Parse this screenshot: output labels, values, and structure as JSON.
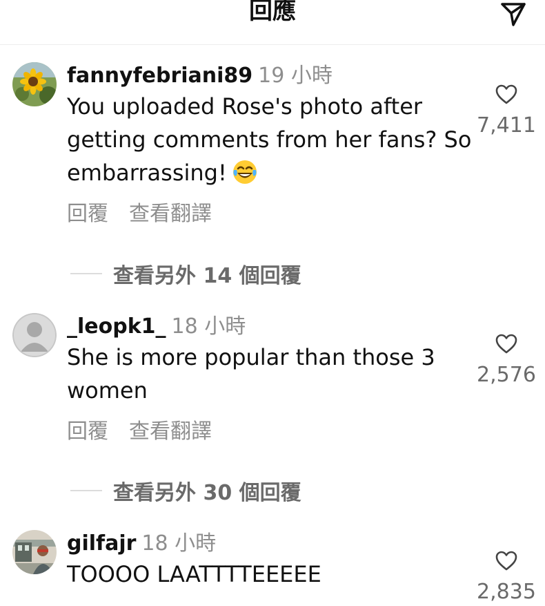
{
  "header": {
    "title": "回應",
    "send_icon": "paper-plane-icon"
  },
  "comments": [
    {
      "username": "fannyfebriani89",
      "time": "19 小時",
      "text": "You uploaded Rose's photo after getting comments from her fans? So embarrassing!",
      "emoji": "laughing-tears-emoji",
      "reply_label": "回覆",
      "translate_label": "查看翻譯",
      "likes": "7,411",
      "view_replies": "查看另外 14 個回覆",
      "avatar": "sunflower-avatar"
    },
    {
      "username": "_leopk1_",
      "time": "18 小時",
      "text": "She is more popular than those 3 women",
      "reply_label": "回覆",
      "translate_label": "查看翻譯",
      "likes": "2,576",
      "view_replies": "查看另外 30 個回覆",
      "avatar": "default-user-avatar"
    },
    {
      "username": "gilfajr",
      "time": "18 小時",
      "text": "TOOOO LAATTTTEEEEE",
      "likes": "2,835",
      "avatar": "photo-avatar"
    }
  ],
  "colors": {
    "primary_text": "#111111",
    "secondary_text": "#8e8e8e",
    "count_text": "#6a6a6a",
    "divider": "#dcdcdc"
  }
}
